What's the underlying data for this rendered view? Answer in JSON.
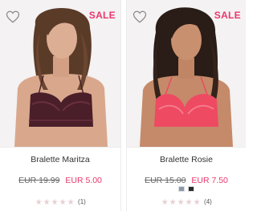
{
  "colors": {
    "sale": "#e8386e",
    "star_empty": "#e8cfd3",
    "text": "#333333"
  },
  "products": [
    {
      "badge": "SALE",
      "name": "Bralette Maritza",
      "old_price": "EUR 19.99",
      "new_price": "EUR 5.00",
      "swatches": [],
      "stars": 5,
      "review_count": "(1)",
      "wishlist_icon": "heart-outline-icon"
    },
    {
      "badge": "SALE",
      "name": "Bralette Rosie",
      "old_price": "EUR 15.00",
      "new_price": "EUR 7.50",
      "swatches": [
        "#8a99ad",
        "#2b2b2e"
      ],
      "stars": 5,
      "review_count": "(4)",
      "wishlist_icon": "heart-outline-icon"
    }
  ]
}
